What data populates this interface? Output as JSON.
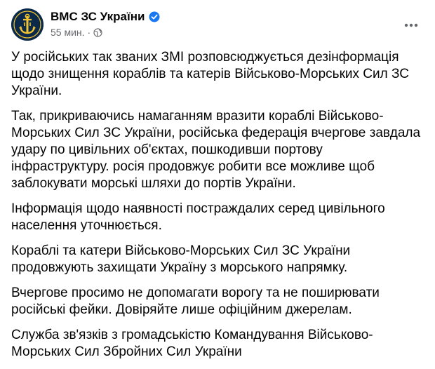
{
  "post": {
    "author": "ВМС ЗС України",
    "verified": true,
    "timestamp": "55 мин.",
    "separator": "·",
    "audience_icon": "globe-icon",
    "more_icon": "more-horizontal-icon",
    "avatar_icon": "navy-emblem-icon",
    "paragraphs": [
      "У російських так званих ЗМІ розповсюджується дезінформація щодо знищення кораблів та катерів Військово-Морських Сил ЗС України.",
      "Так, прикриваючись намаганням вразити кораблі Військово-Морських Сил ЗС України, російська федерація вчергове завдала удару  по цивільних об'єктах, пошкодивши  портову інфраструктуру.  росія продовжує робити все можливе щоб заблокувати  морські шляхи до портів України.",
      "Інформація щодо наявності постраждалих серед цивільного населення уточнюється.",
      "Кораблі та катери Військово-Морських Сил  ЗС України продовжують захищати Україну з морського напрямку.",
      "Вчергове просимо не допомагати ворогу та не поширювати російські фейки. Довіряйте  лише офіційним джерелам.",
      "Служба зв'язків з громадськістю Командування Військово-Морських Сил Збройних Сил України"
    ]
  },
  "colors": {
    "text_primary": "#050505",
    "text_secondary": "#65676b",
    "verified_blue": "#1877f2",
    "avatar_bg": "#0b2a4a",
    "emblem_gold": "#f2c230"
  }
}
